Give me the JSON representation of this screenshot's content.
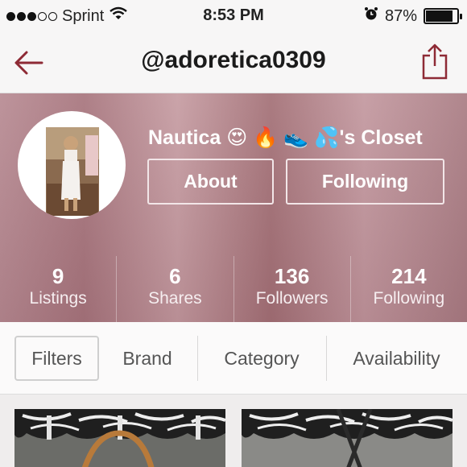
{
  "status_bar": {
    "carrier": "Sprint",
    "time": "8:53 PM",
    "battery": "87%",
    "battery_level": 0.87,
    "signal_bars": 3,
    "signal_total": 5
  },
  "nav": {
    "title": "@adoretica0309",
    "back_icon": "back-arrow-icon",
    "share_icon": "share-icon"
  },
  "profile": {
    "closet_name": "Nautica 😍 🔥 👟 💦's Closet",
    "about_label": "About",
    "following_label": "Following"
  },
  "stats": [
    {
      "value": "9",
      "label": "Listings"
    },
    {
      "value": "6",
      "label": "Shares"
    },
    {
      "value": "136",
      "label": "Followers"
    },
    {
      "value": "214",
      "label": "Following"
    }
  ],
  "filters": {
    "filters_label": "Filters",
    "brand_label": "Brand",
    "category_label": "Category",
    "availability_label": "Availability"
  },
  "colors": {
    "accent": "#8e2a35",
    "header_tint": "#b4868d"
  }
}
